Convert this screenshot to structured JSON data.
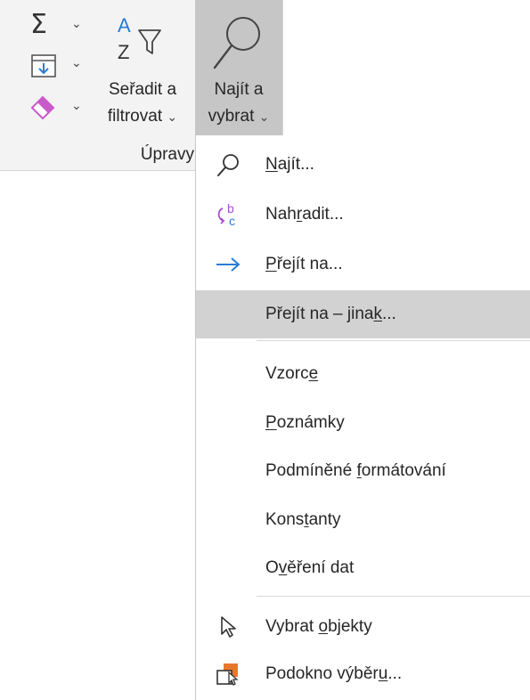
{
  "ribbon": {
    "group_label": "Úpravy",
    "sort_filter": {
      "line1": "Seřadit a",
      "line2": "filtrovat",
      "icon": "sort-filter-icon"
    },
    "find_select": {
      "line1": "Najít a",
      "line2": "vybrat",
      "icon": "search-icon"
    },
    "autosum_icon": "sigma-icon",
    "fill_icon": "fill-down-icon",
    "clear_icon": "eraser-icon",
    "chevron": "⌄"
  },
  "menu": {
    "items": [
      {
        "pre": "",
        "accel": "N",
        "post": "ajít...",
        "icon": "search-icon"
      },
      {
        "pre": "Nah",
        "accel": "r",
        "post": "adit...",
        "icon": "replace-icon"
      },
      {
        "pre": "",
        "accel": "P",
        "post": "řejít na...",
        "icon": "arrow-right-icon"
      },
      {
        "pre": "Přejít na – jina",
        "accel": "k",
        "post": "...",
        "icon": ""
      },
      {
        "pre": "Vzorc",
        "accel": "e",
        "post": "",
        "icon": ""
      },
      {
        "pre": "",
        "accel": "P",
        "post": "oznámky",
        "icon": ""
      },
      {
        "pre": "Podmíněné ",
        "accel": "f",
        "post": "ormátování",
        "icon": ""
      },
      {
        "pre": "Kons",
        "accel": "t",
        "post": "anty",
        "icon": ""
      },
      {
        "pre": "O",
        "accel": "v",
        "post": "ěření dat",
        "icon": ""
      },
      {
        "pre": "Vybrat ",
        "accel": "o",
        "post": "bjekty",
        "icon": "select-objects-icon"
      },
      {
        "pre": "Podokno výběr",
        "accel": "u",
        "post": "...",
        "icon": "selection-pane-icon"
      }
    ],
    "hovered_index": 3
  },
  "colors": {
    "accent_blue": "#2b7cd3",
    "replace_purple": "#a64ed0",
    "eraser_pink": "#c95ac9",
    "pane_orange": "#e8772e"
  }
}
